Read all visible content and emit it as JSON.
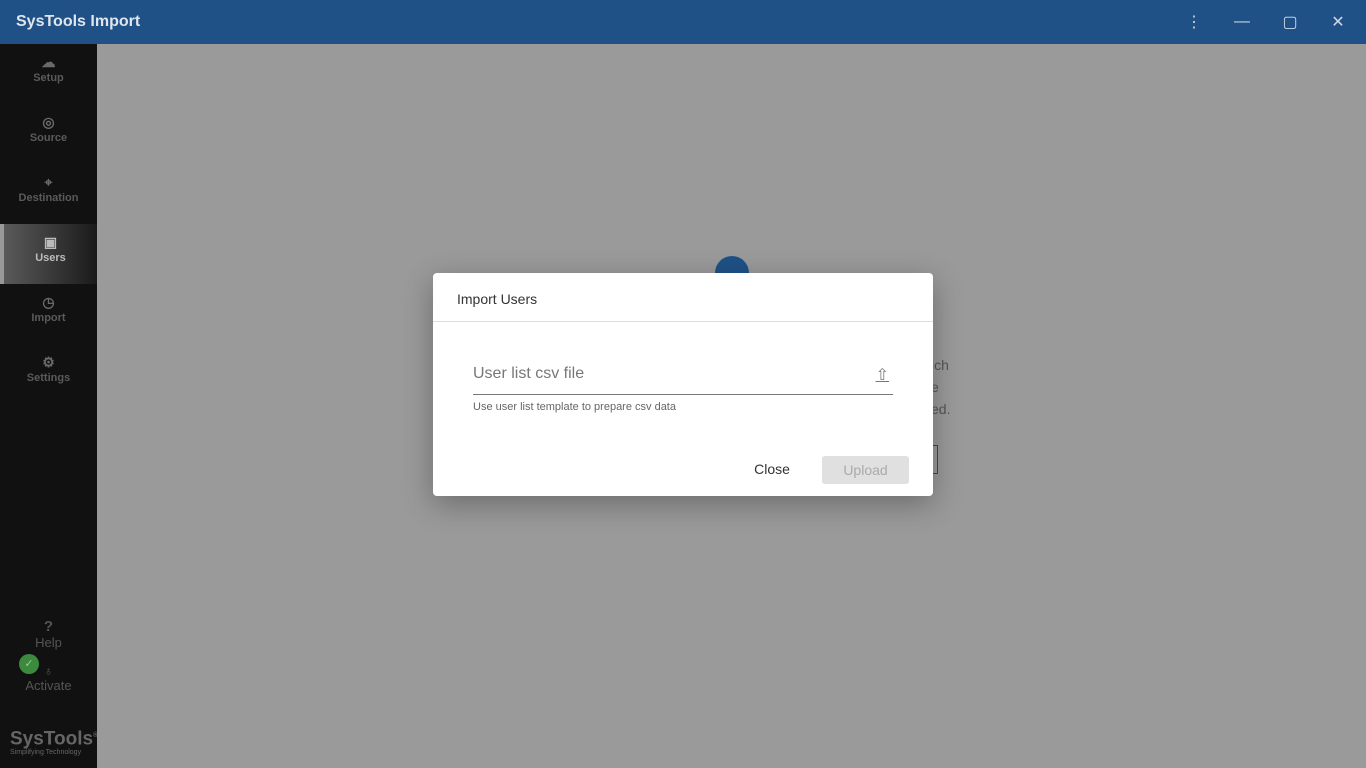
{
  "app": {
    "title": "SysTools Import"
  },
  "window": {
    "menu_icon": "⋮",
    "minimize_icon": "—",
    "maximize_icon": "▢",
    "close_icon": "✕"
  },
  "sidebar": {
    "items": [
      {
        "label": "Setup",
        "icon": "☁"
      },
      {
        "label": "Source",
        "icon": "◎"
      },
      {
        "label": "Destination",
        "icon": "⌖"
      },
      {
        "label": "Users",
        "icon": "▣",
        "active": true
      },
      {
        "label": "Import",
        "icon": "◷"
      },
      {
        "label": "Settings",
        "icon": "⚙"
      }
    ],
    "help": {
      "label": "Help",
      "icon": "?"
    },
    "activate": {
      "label": "Activate",
      "icon": "♁",
      "status_icon": "✓"
    },
    "logo": {
      "name": "SysTools",
      "reg": "®",
      "tagline": "Simplifying Technology"
    }
  },
  "background": {
    "fragments": [
      "ich",
      "e",
      "ed."
    ]
  },
  "dialog": {
    "title": "Import Users",
    "field_placeholder": "User list csv file",
    "upload_icon": "⇧",
    "hint": "Use user list template to prepare csv data",
    "close_label": "Close",
    "upload_label": "Upload"
  },
  "colors": {
    "brand": "#1f5187",
    "success": "#3b8a3e"
  }
}
